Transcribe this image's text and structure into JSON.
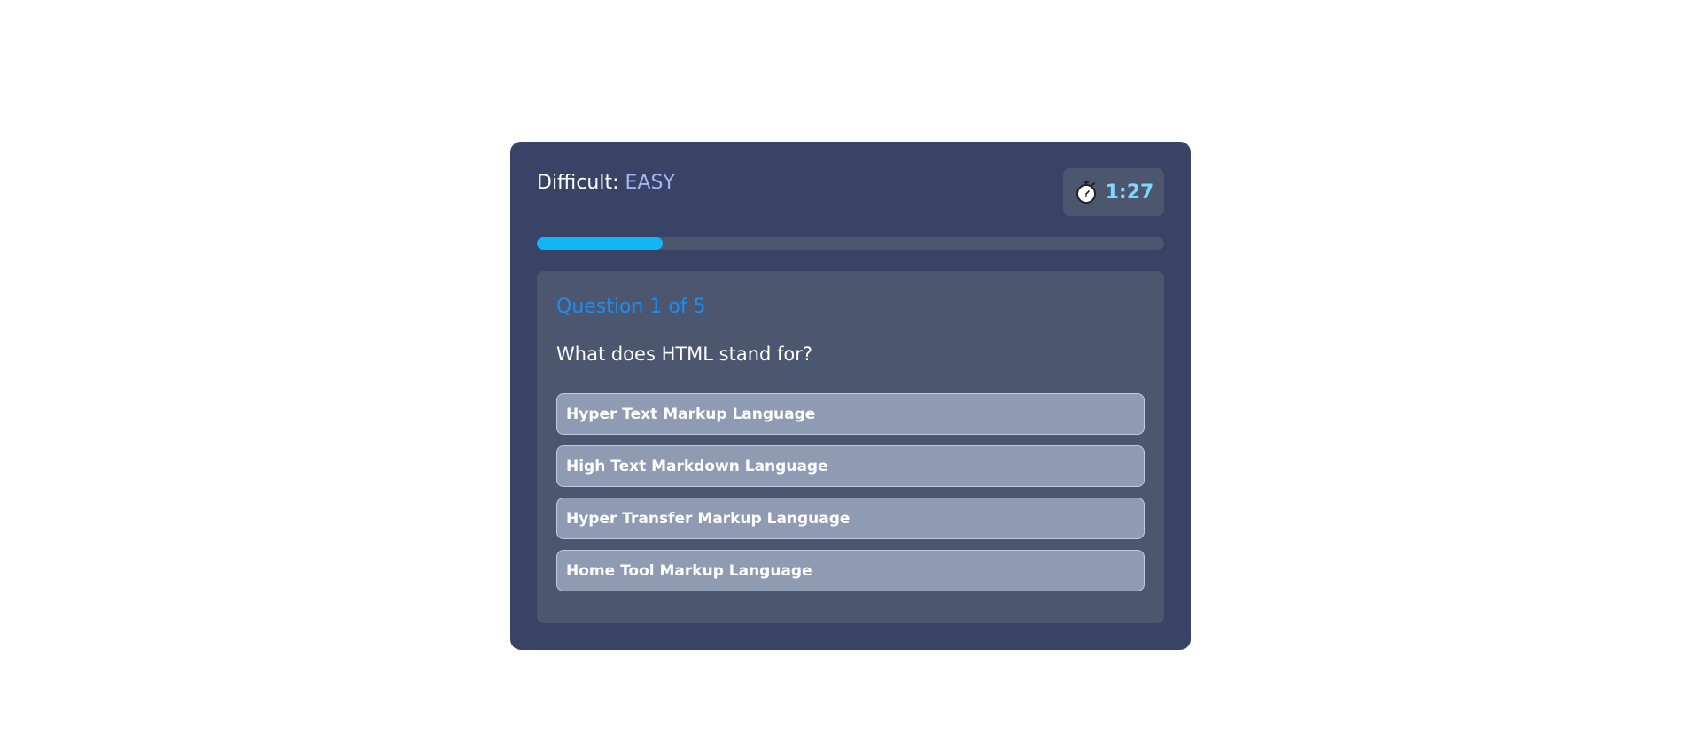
{
  "header": {
    "difficulty_label": "Difficult: ",
    "difficulty_value": "EASY"
  },
  "timer": {
    "icon": "stopwatch-icon",
    "time": "1:27"
  },
  "progress": {
    "fraction": 0.2
  },
  "question": {
    "counter": "Question 1 of 5",
    "text": "What does HTML stand for?",
    "options": [
      "Hyper Text Markup Language",
      "High Text Markdown Language",
      "Hyper Transfer Markup Language",
      "Home Tool Markup Language"
    ]
  },
  "colors": {
    "card_bg": "#394366",
    "panel_bg": "#4c566f",
    "accent": "#0fb8f5",
    "counter": "#1c8ef0",
    "difficulty_value": "#a6b4f5",
    "timer_text": "#7fd6ff",
    "option_bg": "#8f9ab3"
  }
}
